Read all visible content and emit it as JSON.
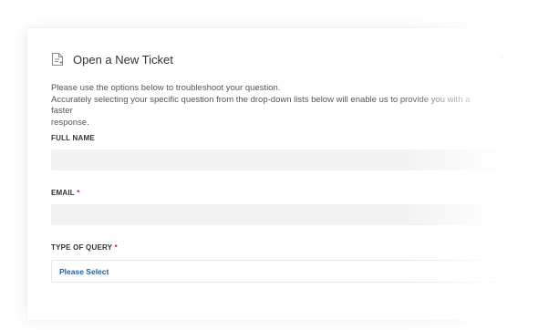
{
  "modal": {
    "title": "Open a New Ticket",
    "description_line1": "Please use the options below to troubleshoot your question.",
    "description_line2": "Accurately selecting your specific question from the drop-down lists below will enable us to provide you with a faster",
    "description_line3": "response.",
    "close_icon": "close-icon",
    "header_icon": "ticket-icon"
  },
  "form": {
    "full_name": {
      "label": "FULL NAME",
      "value": ""
    },
    "email": {
      "label": "EMAIL",
      "required_mark": "*",
      "value": ""
    },
    "query_type": {
      "label": "TYPE OF QUERY",
      "required_mark": "*",
      "selected": "Please Select"
    }
  },
  "colors": {
    "required": "#e11d1d",
    "select_text": "#1f5fa6",
    "input_bg": "#f2f2f2"
  }
}
